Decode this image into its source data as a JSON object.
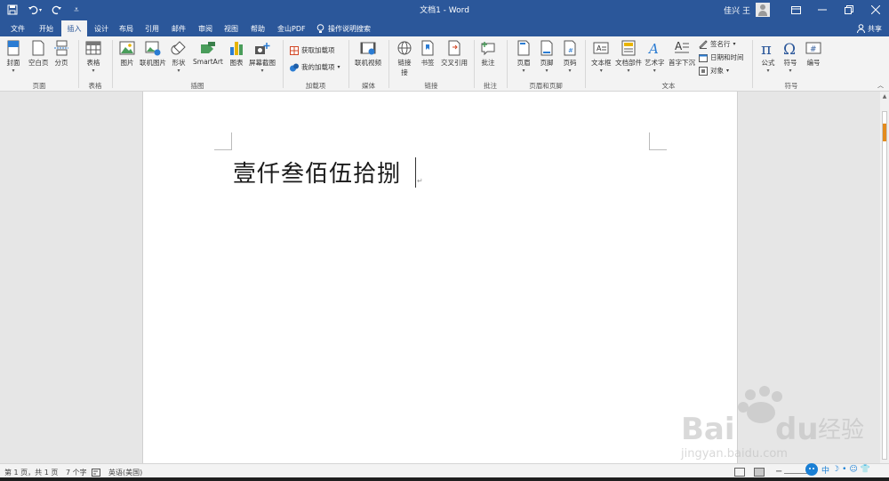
{
  "window": {
    "title": "文档1 - Word",
    "user_name": "佳兴 王",
    "controls": [
      "▭",
      "—",
      "❐",
      "✕"
    ]
  },
  "qat": {
    "save": "💾",
    "undo": "↶",
    "undo_dd": "▾",
    "redo": "↻",
    "customize": "⩡"
  },
  "tabs": [
    {
      "label": "文件"
    },
    {
      "label": "开始"
    },
    {
      "label": "插入"
    },
    {
      "label": "设计"
    },
    {
      "label": "布局"
    },
    {
      "label": "引用"
    },
    {
      "label": "邮件"
    },
    {
      "label": "审阅"
    },
    {
      "label": "视图"
    },
    {
      "label": "帮助"
    },
    {
      "label": "金山PDF"
    }
  ],
  "active_tab": "插入",
  "tellme": {
    "label": "操作说明搜索"
  },
  "share": {
    "label": "共享"
  },
  "ribbon": {
    "cover": "封面",
    "blank": "空白页",
    "pagebreak": "分页",
    "table": "表格",
    "picture": "图片",
    "online_picture": "联机图片",
    "shapes": "形状",
    "smartart": "SmartArt",
    "chart": "图表",
    "screenshot": "屏幕截图",
    "get_addins": "获取加载项",
    "my_addins": "我的加载项",
    "online_video": "联机视频",
    "link": "链接",
    "link2": "接",
    "bookmark": "书签",
    "crossref": "交叉引用",
    "comment": "批注",
    "header": "页眉",
    "footer": "页脚",
    "page_number": "页码",
    "textbox": "文本框",
    "quickparts": "文档部件",
    "wordart": "艺术字",
    "dropcap": "首字下沉",
    "signature": "签名行",
    "datetime": "日期和时间",
    "object": "对象",
    "equation": "公式",
    "symbol": "符号",
    "number": "编号",
    "groups": {
      "pages": "页面",
      "tables": "表格",
      "illustrations": "插图",
      "addins": "加载项",
      "media": "媒体",
      "links": "链接",
      "comments": "批注",
      "header_footer": "页眉和页脚",
      "text": "文本",
      "symbols": "符号"
    }
  },
  "document": {
    "text": "壹仟叁佰伍拾捌",
    "para_mark": "↵"
  },
  "status": {
    "page": "第 1 页，共 1 页",
    "words": "7 个字",
    "language": "英语(美国)",
    "zoom_minus": "−"
  },
  "watermark": {
    "brand": "Bai",
    "brand2": "du",
    "brand_cn": "经验",
    "url": "jingyan.baidu.com"
  },
  "ime": {
    "lang": "中",
    "moon": "☽",
    "dot": "•",
    "smile": "☺",
    "shirt": "👕"
  },
  "colors": {
    "titlebar": "#2b579a",
    "ribbon": "#f3f3f3",
    "workspace": "#e6e6e6",
    "accent": "#e38b1f"
  }
}
